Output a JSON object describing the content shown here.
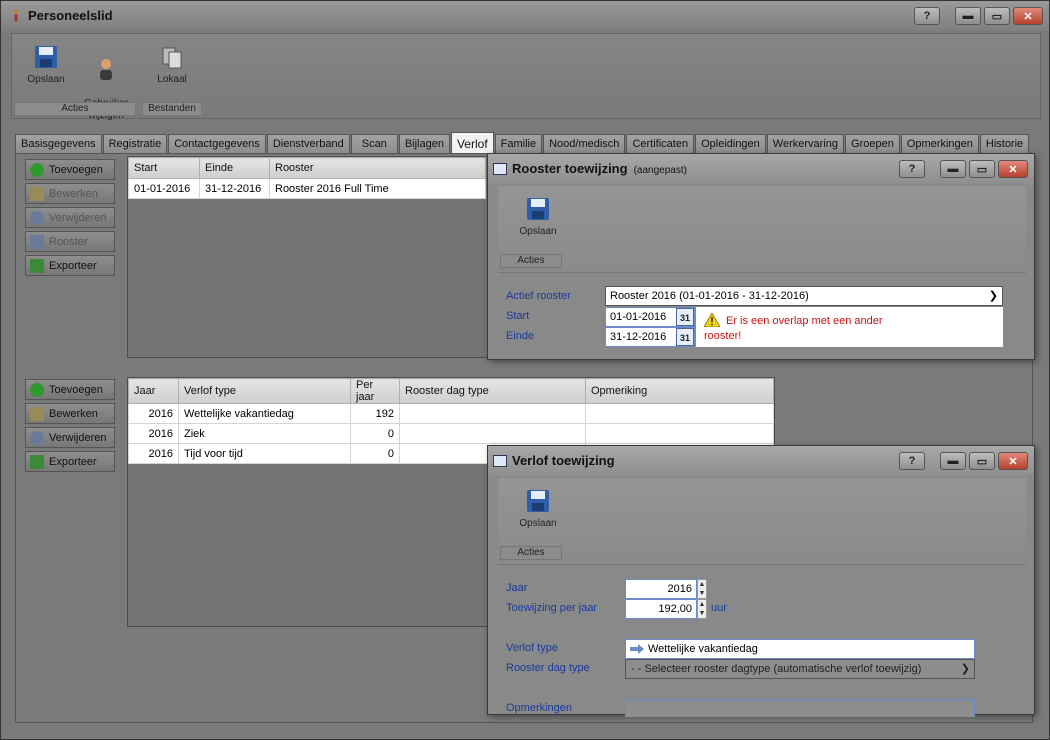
{
  "window": {
    "title": "Personeelslid",
    "help": "?",
    "minimize": "▬",
    "restore": "▭",
    "close": "✕"
  },
  "ribbon": {
    "buttons": [
      {
        "label": "Opslaan",
        "icon": "floppy-disk-icon"
      },
      {
        "label": "Gebruiker\nwijzigen",
        "icon": "user-icon"
      },
      {
        "label": "Lokaal",
        "icon": "files-icon"
      }
    ],
    "groups": [
      "Acties",
      "Bestanden"
    ]
  },
  "tabs": [
    "Basisgegevens",
    "Registratie",
    "Contactgegevens",
    "Dienstverband",
    "Scan",
    "Bijlagen",
    "Verlof",
    "Familie",
    "Nood/medisch",
    "Certificaten",
    "Opleidingen",
    "Werkervaring",
    "Groepen",
    "Opmerkingen",
    "Historie"
  ],
  "active_tab": "Verlof",
  "roster_actions": [
    "Toevoegen",
    "Bewerken",
    "Verwijderen",
    "Rooster",
    "Exporteer"
  ],
  "leave_actions": [
    "Toevoegen",
    "Bewerken",
    "Verwijderen",
    "Exporteer"
  ],
  "roster_table": {
    "columns": [
      "Start",
      "Einde",
      "Rooster"
    ],
    "rows": [
      [
        "01-01-2016",
        "31-12-2016",
        "Rooster 2016 Full Time"
      ]
    ]
  },
  "leave_table": {
    "columns": [
      "Jaar",
      "Verlof type",
      "Per jaar",
      "Rooster dag type",
      "Opmeriking"
    ],
    "rows": [
      [
        "2016",
        "Wettelijke vakantiedag",
        "192",
        "",
        ""
      ],
      [
        "2016",
        "Ziek",
        "0",
        "",
        ""
      ],
      [
        "2016",
        "Tijd voor tijd",
        "0",
        "",
        ""
      ]
    ]
  },
  "rooster_dialog": {
    "title": "Rooster toewijzing",
    "subtitle": "(aangepast)",
    "save": "Opslaan",
    "group": "Acties",
    "active_label": "Actief rooster",
    "active_value": "Rooster 2016 (01-01-2016 - 31-12-2016)",
    "start_label": "Start",
    "start_value": "01-01-2016",
    "end_label": "Einde",
    "end_value": "31-12-2016",
    "calendar": "31",
    "warning": "Er is een overlap met een ander",
    "warning2": "rooster!"
  },
  "verlof_dialog": {
    "title": "Verlof toewijzing",
    "save": "Opslaan",
    "group": "Acties",
    "year_label": "Jaar",
    "year_value": "2016",
    "alloc_label": "Toewijzing per jaar",
    "alloc_value": "192,00",
    "unit": "uur",
    "type_label": "Verlof type",
    "type_value": "Wettelijke vakantiedag",
    "daytype_label": "Rooster dag type",
    "daytype_value": "- - Selecteer rooster dagtype (automatische verlof toewijzig)",
    "notes_label": "Opmerkingen"
  }
}
